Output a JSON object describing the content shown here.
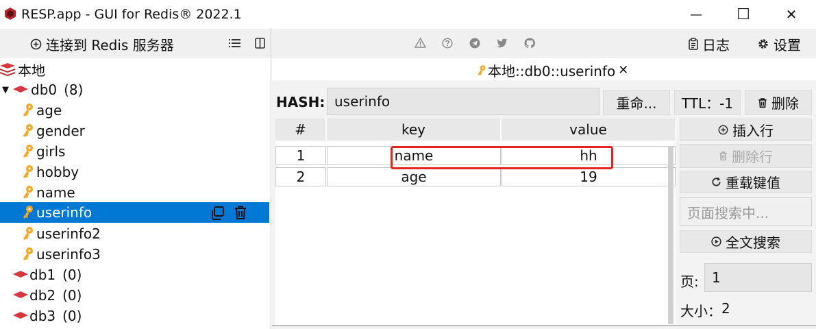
{
  "window": {
    "title": "RESP.app - GUI for Redis® 2022.1",
    "minimize_glyph": "—",
    "maximize_glyph": "☐",
    "close_glyph": "✕"
  },
  "toolbar": {
    "connect_label": "连接到 Redis 服务器",
    "log_label": "日志",
    "settings_label": "设置",
    "icons": [
      "warning-icon",
      "help-icon",
      "telegram-icon",
      "twitter-icon",
      "github-icon"
    ]
  },
  "tree": {
    "root_label": "本地",
    "db0": {
      "name": "db0",
      "count": "(8)"
    },
    "keys": [
      "age",
      "gender",
      "girls",
      "hobby",
      "name",
      "userinfo",
      "userinfo2",
      "userinfo3"
    ],
    "selected_key": "userinfo",
    "other_dbs": [
      {
        "name": "db1",
        "count": "(0)"
      },
      {
        "name": "db2",
        "count": "(0)"
      },
      {
        "name": "db3",
        "count": "(0)"
      }
    ]
  },
  "tab": {
    "label": "本地::db0::userinfo"
  },
  "key_view": {
    "type_label": "HASH:",
    "key_name": "userinfo",
    "rename_label": "重命...",
    "ttl_label": "TTL：-1",
    "delete_label": "删除"
  },
  "table": {
    "columns": [
      "#",
      "key",
      "value"
    ],
    "rows": [
      {
        "index": "1",
        "key": "name",
        "value": "hh"
      },
      {
        "index": "2",
        "key": "age",
        "value": "19"
      }
    ]
  },
  "side_actions": {
    "insert_row": "插入行",
    "delete_row": "删除行",
    "reload": "重载键值",
    "search_placeholder": "页面搜索中...",
    "fulltext_search": "全文搜索",
    "page_label": "页:",
    "page_value": "1",
    "size_label": "大小：",
    "size_value": "2"
  },
  "colors": {
    "selection": "#0078d4",
    "highlight": "#e8231f",
    "key_icon": "#f5a623",
    "db_icon": "#d9363e"
  }
}
